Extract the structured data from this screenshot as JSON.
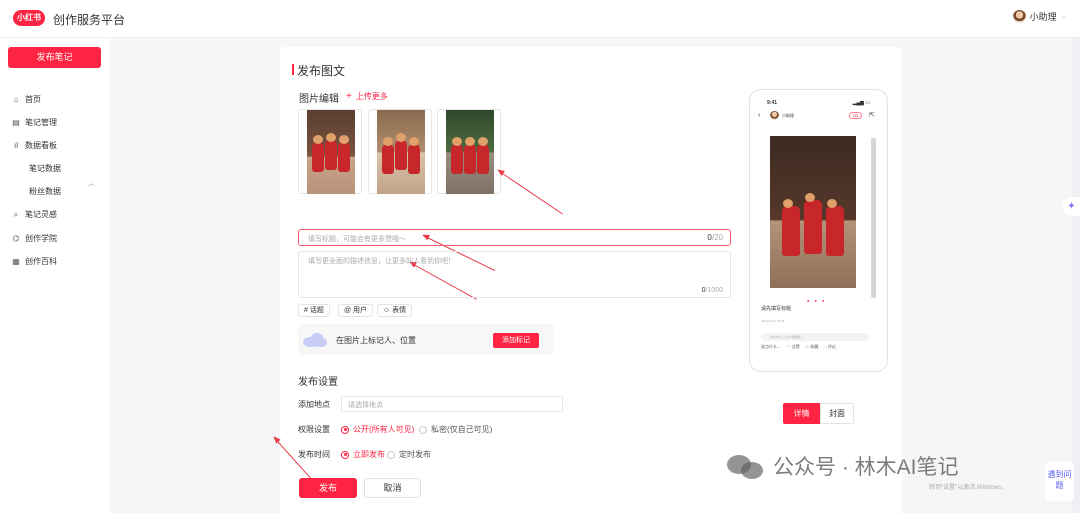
{
  "header": {
    "logo": "小红书",
    "platform": "创作服务平台",
    "user": "小助理"
  },
  "sidebar": {
    "publish": "发布笔记",
    "items": [
      "首页",
      "笔记管理",
      "数据看板",
      "笔记灵感",
      "创作学院",
      "创作百科"
    ],
    "subitems": [
      "笔记数据",
      "粉丝数据"
    ]
  },
  "main": {
    "title": "发布图文",
    "image_edit": "图片编辑",
    "upload_more": "上传更多",
    "title_placeholder": "填写标题，可能会有更多赞哦～",
    "title_count": "0",
    "title_max": "/20",
    "desc_placeholder": "填写更全面的描述信息，让更多的人看到你吧！",
    "desc_count": "0",
    "desc_max": "/1000",
    "tags": [
      "# 话题",
      "@ 用户",
      "☺ 表情"
    ],
    "mark_text": "在图片上标记人、位置",
    "mark_button": "添加标记",
    "settings_title": "发布设置",
    "location_label": "添加地点",
    "location_placeholder": "请选择地点",
    "permission_label": "权限设置",
    "permission_public": "公开(所有人可见)",
    "permission_private": "私密(仅自己可见)",
    "time_label": "发布时间",
    "time_now": "立即发布",
    "time_scheduled": "定时发布",
    "publish_button": "发布",
    "cancel_button": "取消"
  },
  "preview": {
    "time": "9:41",
    "name": "小助理",
    "page_indicator": "1/3",
    "caption": "请先填写标题",
    "date": "2024-03-11 15:46",
    "comment_placeholder": "说点什么，让TA更懂你…",
    "actions": [
      "说点什么…",
      "点赞",
      "收藏",
      "评论"
    ],
    "tab_detail": "详情",
    "tab_cover": "封面"
  },
  "floating": {
    "help": "遇到问题"
  },
  "watermark": {
    "text": "公众号 · 林木AI笔记",
    "note": "转到\"设置\"以激活 Windows。"
  },
  "colors": {
    "accent": "#ff2442"
  }
}
